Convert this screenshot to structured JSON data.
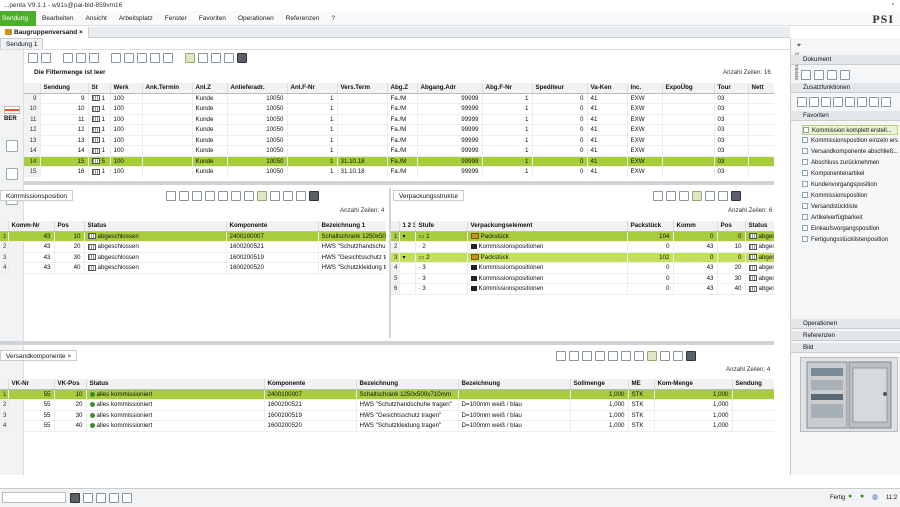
{
  "app": {
    "title": "...penta V9.1.1 - w91s@pai-bld-859vm16",
    "logo": "PSI"
  },
  "menu": [
    "Sendung",
    "Bearbeiten",
    "Ansicht",
    "Arbeitsplatz",
    "Fenster",
    "Favoriten",
    "Operationen",
    "Referenzen",
    "?"
  ],
  "tabs": {
    "main": "Baugruppenversand",
    "sub": "Sendung 1"
  },
  "left_strip": {
    "flag_label": "BER"
  },
  "top_panel": {
    "filter_msg": "Die Filtermenge ist leer",
    "count": "Anzahl Zeilen: 16",
    "columns": [
      "Sendung",
      "St",
      "Werk",
      "Ank.Termin",
      "Anl.Z",
      "Anlieferadr.",
      "Anl.F-Nr",
      "Vers.Term",
      "Abg.Z",
      "Abgang.Adr",
      "Abg.F-Nr",
      "Spediteur",
      "Va-Ken",
      "Inc.",
      "ExpoÜbg",
      "Tour",
      "Nett"
    ],
    "rows": [
      {
        "n": "9",
        "c": [
          "9",
          "1",
          "100",
          "",
          "Kunde",
          "10050",
          "1",
          "",
          "Fa./M",
          "99999",
          "1",
          "0",
          "41",
          "EXW",
          "",
          "03",
          ""
        ]
      },
      {
        "n": "10",
        "c": [
          "10",
          "1",
          "100",
          "",
          "Kunde",
          "10050",
          "1",
          "",
          "Fa./M",
          "99999",
          "1",
          "0",
          "41",
          "EXW",
          "",
          "03",
          ""
        ]
      },
      {
        "n": "11",
        "c": [
          "11",
          "1",
          "100",
          "",
          "Kunde",
          "10050",
          "1",
          "",
          "Fa./M",
          "99999",
          "1",
          "0",
          "41",
          "EXW",
          "",
          "03",
          ""
        ]
      },
      {
        "n": "12",
        "c": [
          "12",
          "1",
          "100",
          "",
          "Kunde",
          "10050",
          "1",
          "",
          "Fa./M",
          "99999",
          "1",
          "0",
          "41",
          "EXW",
          "",
          "03",
          ""
        ]
      },
      {
        "n": "13",
        "c": [
          "13",
          "1",
          "100",
          "",
          "Kunde",
          "10050",
          "1",
          "",
          "Fa./M",
          "99999",
          "1",
          "0",
          "41",
          "EXW",
          "",
          "03",
          ""
        ]
      },
      {
        "n": "14",
        "c": [
          "14",
          "1",
          "100",
          "",
          "Kunde",
          "10050",
          "1",
          "",
          "Fa./M",
          "99999",
          "1",
          "0",
          "41",
          "EXW",
          "",
          "03",
          ""
        ]
      },
      {
        "n": "14",
        "c": [
          "15",
          "5",
          "100",
          "",
          "Kunde",
          "10050",
          "1",
          "31.10.18",
          "Fa./M",
          "99999",
          "1",
          "0",
          "41",
          "EXW",
          "",
          "03",
          ""
        ],
        "sel": true
      },
      {
        "n": "15",
        "c": [
          "16",
          "1",
          "100",
          "",
          "Kunde",
          "10050",
          "1",
          "31.10.18",
          "Fa./M",
          "99999",
          "1",
          "0",
          "41",
          "EXW",
          "",
          "03",
          ""
        ]
      },
      {
        "n": "16",
        "c": [
          "1001",
          "1",
          "100",
          "",
          "Kunde",
          "10012",
          "1",
          "",
          "Fa./M",
          "0",
          "1",
          "0",
          "",
          "",
          "",
          "",
          ""
        ]
      }
    ]
  },
  "komm_panel": {
    "title": "Kommissionsposition",
    "count": "Anzahl Zeilen: 4",
    "columns": [
      "Komm-Nr",
      "Pos",
      "Status",
      "Komponente",
      "Bezeichnung 1"
    ],
    "rows": [
      {
        "n": "1",
        "c": [
          "43",
          "10",
          "abgeschlossen",
          "2400100007",
          "Schaltschrank 1250x500"
        ],
        "sel": true
      },
      {
        "n": "2",
        "c": [
          "43",
          "20",
          "abgeschlossen",
          "1600200521",
          "HWS \"Schutzhandschuh"
        ]
      },
      {
        "n": "3",
        "c": [
          "43",
          "30",
          "abgeschlossen",
          "1600200519",
          "HWS \"Gesichtsschutz tra"
        ]
      },
      {
        "n": "4",
        "c": [
          "43",
          "40",
          "abgeschlossen",
          "1600200520",
          "HWS \"Schutzkleidung tr"
        ]
      }
    ]
  },
  "verp_panel": {
    "title": "Verpackungsstruktur",
    "count": "Anzahl Zeilen: 6",
    "columns": [
      "1 2 3",
      "Stufe",
      "Verpackungselement",
      "Packstück",
      "Komm",
      "Pos",
      "Status"
    ],
    "rows": [
      {
        "n": "1",
        "c": [
          "",
          "1",
          "Packstück",
          "104",
          "0",
          "0",
          "abges"
        ],
        "type": "pack",
        "sel": true
      },
      {
        "n": "2",
        "c": [
          "",
          "2",
          "Kommissionspositionen",
          "0",
          "43",
          "10",
          "abges"
        ],
        "type": "komm"
      },
      {
        "n": "3",
        "c": [
          "",
          "2",
          "Packstück",
          "102",
          "0",
          "0",
          "abges"
        ],
        "type": "pack",
        "hl": true
      },
      {
        "n": "4",
        "c": [
          "",
          "3",
          "Kommissionspositionen",
          "0",
          "43",
          "20",
          "abges"
        ],
        "type": "komm"
      },
      {
        "n": "5",
        "c": [
          "",
          "3",
          "Kommissionspositionen",
          "0",
          "43",
          "30",
          "abges"
        ],
        "type": "komm"
      },
      {
        "n": "6",
        "c": [
          "",
          "3",
          "Kommissionspositionen",
          "0",
          "43",
          "40",
          "abges"
        ],
        "type": "komm"
      }
    ]
  },
  "versand_panel": {
    "title": "Versandkomponente",
    "count": "Anzahl Zeilen: 4",
    "columns": [
      "VK-Nr",
      "VK-Pos",
      "Status",
      "Komponente",
      "Bezeichnung",
      "Bezeichnung",
      "Sollmenge",
      "ME",
      "Kom-Menge",
      "Sendung"
    ],
    "rows": [
      {
        "n": "1",
        "c": [
          "55",
          "10",
          "alles kommissioniert",
          "2400100007",
          "Schaltschrank 1250x500x710mm",
          "",
          "1,000",
          "STK",
          "1,000",
          ""
        ],
        "sel": true
      },
      {
        "n": "2",
        "c": [
          "55",
          "20",
          "alles kommissioniert",
          "1600200521",
          "HWS \"Schutzhandschuhe tragen\"",
          "D=100mm weiß / blau",
          "1,000",
          "STK",
          "1,000",
          ""
        ]
      },
      {
        "n": "3",
        "c": [
          "55",
          "30",
          "alles kommissioniert",
          "1600200519",
          "HWS \"Gesichtsschutz tragen\"",
          "D=100mm weiß / blau",
          "1,000",
          "STK",
          "1,000",
          ""
        ]
      },
      {
        "n": "4",
        "c": [
          "55",
          "40",
          "alles kommissioniert",
          "1600200520",
          "HWS \"Schutzkleidung tragen\"",
          "D=100mm weiß / blau",
          "1,000",
          "STK",
          "1,000",
          ""
        ]
      }
    ]
  },
  "right_panel": {
    "sidebar_label": "Seitenleiste",
    "dokument": "Dokument",
    "zusatz": "Zusatzfunktionen",
    "favoriten": "Favoriten",
    "fav_items": [
      "Kommission komplett erstell...",
      "Kommissionsposition einzeln ers",
      "Versandkomponente abschließ...",
      "Abschluss zurücknehmen",
      "Komponentenartikel",
      "Kundenvorgangsposition",
      "Kommissionsposition",
      "Versandstückliste",
      "Artikelverfügbarkeit",
      "Einkaufsvorgangsposition",
      "Fertigungsstücklistenposition"
    ],
    "operationen": "Operationen",
    "referenzen": "Referenzen",
    "bild": "Bild"
  },
  "status": {
    "state": "Fertig",
    "time": "11:2"
  },
  "colors": {
    "selected": "#a8cd3c",
    "menu_active": "#4caf2a"
  }
}
